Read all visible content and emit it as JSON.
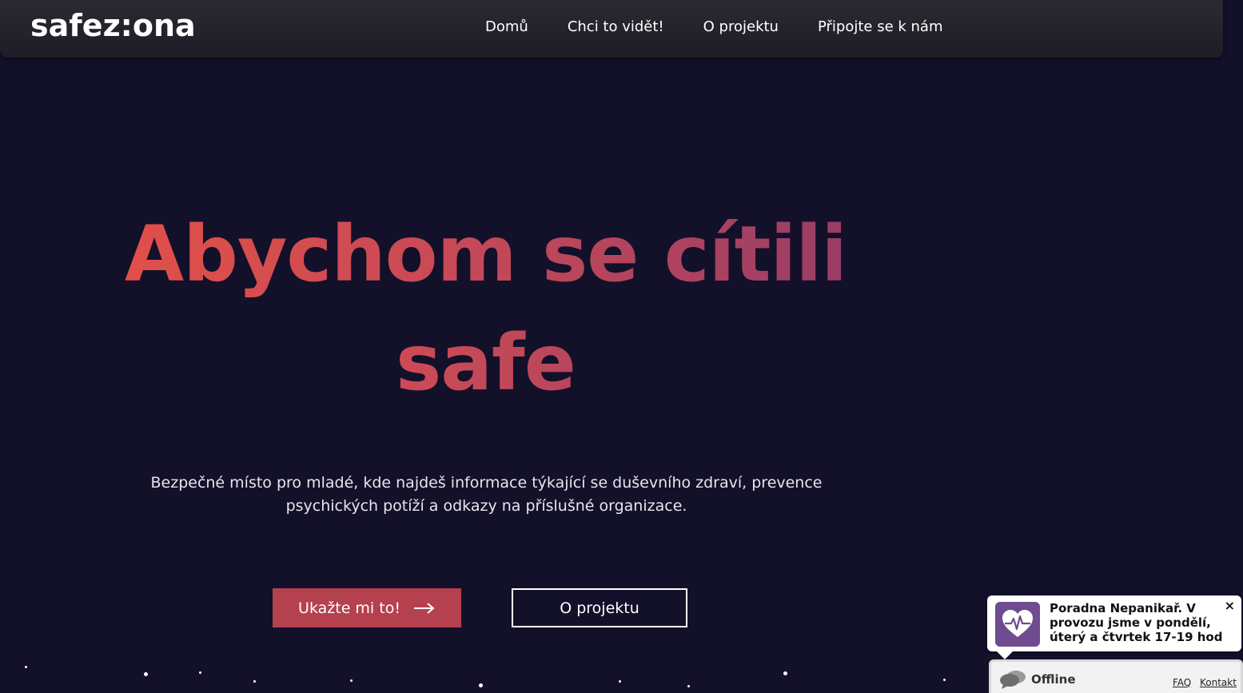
{
  "header": {
    "logo": "safez:ona",
    "nav": [
      {
        "label": "Domů"
      },
      {
        "label": "Chci to vidět!"
      },
      {
        "label": "O projektu"
      },
      {
        "label": "Připojte se k nám"
      }
    ]
  },
  "hero": {
    "title_line1": "Abychom se cítili",
    "title_line2": "safe",
    "subtitle": "Bezpečné místo pro mladé, kde najdeš informace týkající se duševního zdraví, prevence psychických potíží a odkazy na příslušné organizace.",
    "primary_button": "Ukažte mi to!",
    "secondary_button": "O projektu",
    "gradient_colors": [
      "#ea5144",
      "#8b3a6b"
    ]
  },
  "chat_widget": {
    "message": "Poradna Nepanikař. V provozu jsme v pondělí, úterý a čtvrtek 17-19 hod",
    "close_symbol": "×",
    "status": "Offline",
    "links": {
      "faq": "FAQ",
      "contact": "Kontakt"
    },
    "icon": "heart-pulse-icon",
    "accent_color": "#6f4b8f"
  },
  "colors": {
    "background": "#13102a",
    "primary_button": "#b5404e"
  }
}
